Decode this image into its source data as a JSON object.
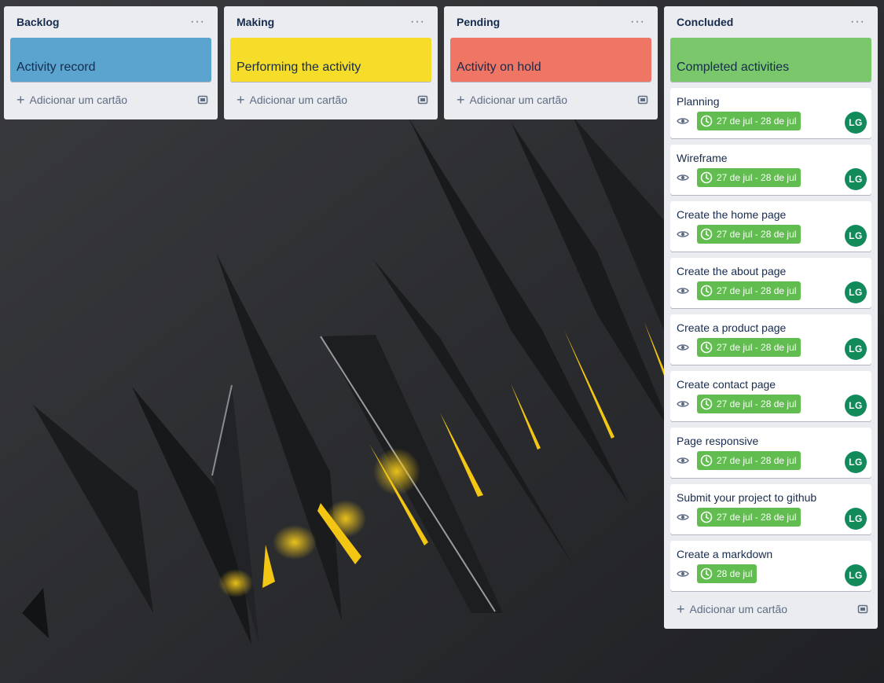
{
  "colors": {
    "list_bg": "#ebecf0",
    "cover_blue": "#5ba4cf",
    "cover_yellow": "#f5dd29",
    "cover_red": "#ef7564",
    "cover_green": "#7bc86c",
    "due_green": "#61bd4f",
    "avatar_green": "#138a5a"
  },
  "lists": [
    {
      "title": "Backlog",
      "menu": "···",
      "cover": {
        "label": "Activity record",
        "color": "#5ba4cf"
      },
      "add_card": "Adicionar um cartão"
    },
    {
      "title": "Making",
      "menu": "···",
      "cover": {
        "label": "Performing the activity",
        "color": "#f5dd29"
      },
      "add_card": "Adicionar um cartão"
    },
    {
      "title": "Pending",
      "menu": "···",
      "cover": {
        "label": "Activity on hold",
        "color": "#ef7564"
      },
      "add_card": "Adicionar um cartão"
    },
    {
      "title": "Concluded",
      "menu": "···",
      "cover": {
        "label": "Completed activities",
        "color": "#7bc86c"
      },
      "add_card": "Adicionar um cartão",
      "cards": [
        {
          "title": "Planning",
          "due": "27 de jul - 28 de jul",
          "member": "LG"
        },
        {
          "title": "Wireframe",
          "due": "27 de jul - 28 de jul",
          "member": "LG"
        },
        {
          "title": "Create the home page",
          "due": "27 de jul - 28 de jul",
          "member": "LG"
        },
        {
          "title": "Create the about page",
          "due": "27 de jul - 28 de jul",
          "member": "LG"
        },
        {
          "title": "Create a product page",
          "due": "27 de jul - 28 de jul",
          "member": "LG"
        },
        {
          "title": "Create contact page",
          "due": "27 de jul - 28 de jul",
          "member": "LG"
        },
        {
          "title": "Page responsive",
          "due": "27 de jul - 28 de jul",
          "member": "LG"
        },
        {
          "title": "Submit your project to github",
          "due": "27 de jul - 28 de jul",
          "member": "LG"
        },
        {
          "title": "Create a markdown",
          "due": "28 de jul",
          "member": "LG"
        }
      ]
    }
  ]
}
